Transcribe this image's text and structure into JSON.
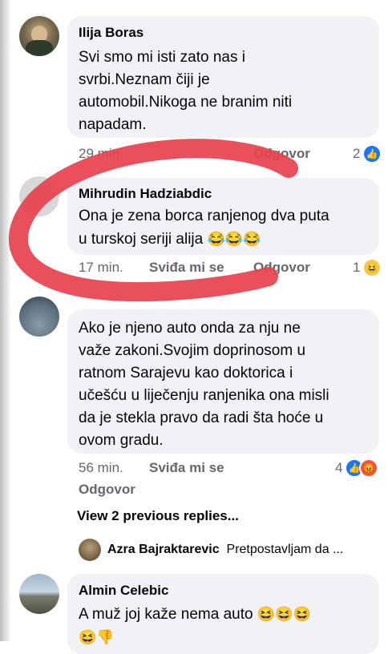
{
  "comments": [
    {
      "author": "Ilija Boras",
      "text_lines": [
        "Svi smo mi isti  zato nas i",
        "svrbi.Neznam čiji je",
        "automobil.Nikoga ne branim niti",
        "napadam."
      ],
      "time": "29 min.",
      "reply_label": "Odgovor",
      "reaction_count": "2",
      "reactions": [
        "like-icon"
      ]
    },
    {
      "author": "Mihrudin Hadziabdic",
      "text_lines": [
        "Ona je zena borca ranjenog dva puta",
        "u turskoj seriji alija"
      ],
      "emoji_suffix": "😂😂😂",
      "time": "17 min.",
      "like_label": "Sviđa mi se",
      "reply_label": "Odgovor",
      "reaction_count": "1",
      "reactions": [
        "haha-icon"
      ]
    },
    {
      "author": "",
      "text_lines": [
        "Ako je njeno auto onda za nju ne",
        "važe zakoni.Svojim doprinosom u",
        "ratnom Sarajevu kao doktorica i",
        "učešću u liječenju ranjenika ona misli",
        "da je stekla pravo da radi šta hoće u",
        "ovom gradu."
      ],
      "time": "56 min.",
      "like_label": "Sviđa mi se",
      "reply_label": "Odgovor",
      "reaction_count": "4",
      "reactions": [
        "like-icon",
        "angry-icon"
      ]
    }
  ],
  "view_previous": "View 2 previous replies...",
  "reply_preview": {
    "author": "Azra Bajraktarevic",
    "text": "Pretpostavljam da ..."
  },
  "last_comment": {
    "author": "Almin Celebic",
    "text": "A muž joj kaže nema auto",
    "emoji_suffix": "😆😆😆",
    "emoji_line2": "😆👎"
  },
  "colors": {
    "bubble": "#f0f2f5",
    "meta_text": "#65676b",
    "like_blue": "#1877f2",
    "red_marker": "#e8404e"
  }
}
